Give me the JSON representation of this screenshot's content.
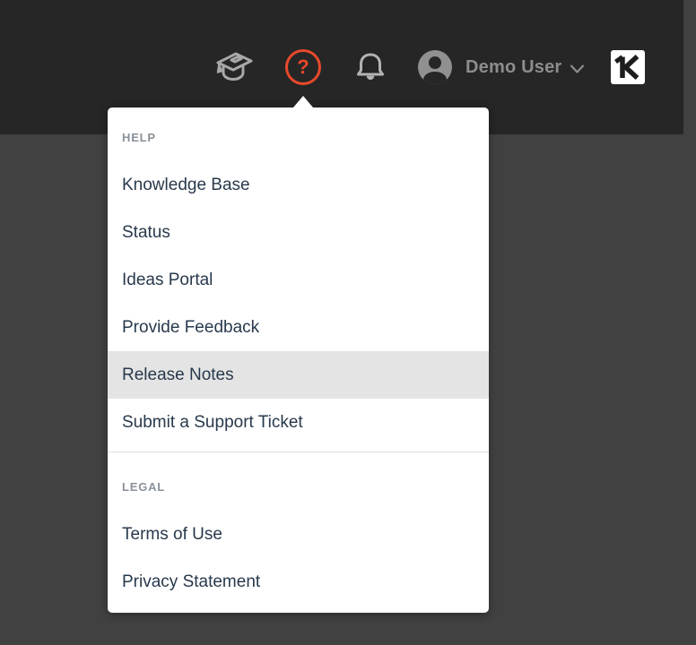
{
  "header": {
    "user": {
      "name": "Demo User"
    },
    "help_glyph": "?",
    "icons": {
      "academy": "graduation-cap",
      "help": "question-mark-circle",
      "notifications": "bell",
      "account": "person-avatar",
      "chevron": "chevron-down",
      "brand": "khoros-k-logo"
    }
  },
  "help_menu": {
    "sections": [
      {
        "label": "HELP",
        "items": [
          {
            "label": "Knowledge Base",
            "highlighted": false
          },
          {
            "label": "Status",
            "highlighted": false
          },
          {
            "label": "Ideas Portal",
            "highlighted": false
          },
          {
            "label": "Provide Feedback",
            "highlighted": false
          },
          {
            "label": "Release Notes",
            "highlighted": true
          },
          {
            "label": "Submit a Support Ticket",
            "highlighted": false
          }
        ]
      },
      {
        "label": "LEGAL",
        "items": [
          {
            "label": "Terms of Use",
            "highlighted": false
          },
          {
            "label": "Privacy Statement",
            "highlighted": false
          }
        ]
      }
    ]
  },
  "colors": {
    "header_bg": "#262626",
    "page_bg": "#414141",
    "accent_orange": "#e8492b",
    "menu_bg": "#ffffff",
    "menu_text": "#28394c",
    "section_label": "#8a9199",
    "highlight_bg": "#e4e4e4",
    "icon_gray": "#aaaaaa"
  }
}
